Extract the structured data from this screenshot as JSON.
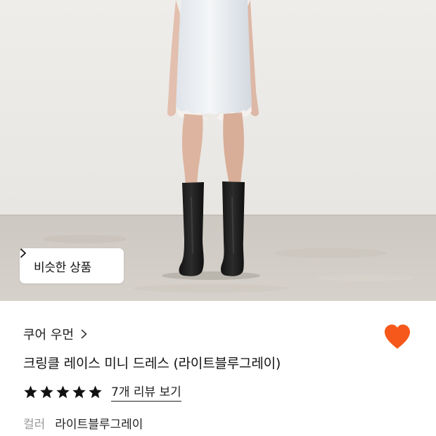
{
  "product": {
    "similar_button_label": "비슷한 상품",
    "brand": "쿠어 우먼",
    "name": "크링클 레이스 미니 드레스 (라이트블루그레이)",
    "rating_stars": 5,
    "review_link": "7개 리뷰 보기",
    "color_label": "컬러",
    "color_value": "라이트블루그레이",
    "wishlisted": true
  },
  "colors": {
    "heart": "#f5581a",
    "wall": "#eceae7",
    "floor": "#cfcac3"
  },
  "icons": [
    "chevron-right-icon",
    "heart-icon",
    "star-icon"
  ]
}
